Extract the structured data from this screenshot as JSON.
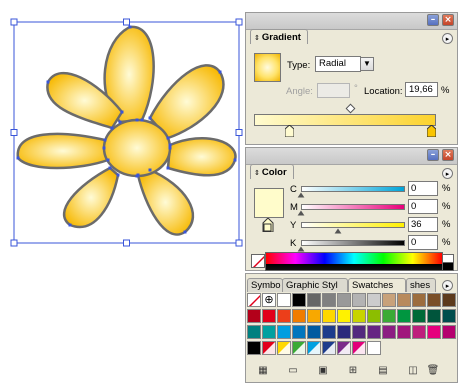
{
  "colors": {
    "panel_bg": "#ece9d8",
    "petal_fill_light": "#fffbd6",
    "petal_fill_dark": "#f7b800",
    "petal_stroke": "#6b6b6b",
    "selection": "#3a55d9",
    "accent_close": "#c4442a",
    "accent_min": "#5670c0"
  },
  "artboard": {
    "object": "flower-shape",
    "selected": true
  },
  "gradient_panel": {
    "tab_label": "Gradient",
    "type_label": "Type:",
    "type_value": "Radial",
    "angle_label": "Angle:",
    "angle_unit": "°",
    "location_label": "Location:",
    "location_value": "19,66",
    "location_unit": "%",
    "stops": [
      {
        "color": "#fffbd0",
        "position": 0
      },
      {
        "color": "#fcd22c",
        "position": 100
      }
    ],
    "midpoint": 53
  },
  "color_panel": {
    "tab_label": "Color",
    "swatch_color": "#fffccb",
    "channels": [
      {
        "label": "C",
        "value": "0",
        "unit": "%",
        "level": 0,
        "track": "linear-gradient(to right,#ffffff,#00a4d8)"
      },
      {
        "label": "M",
        "value": "0",
        "unit": "%",
        "level": 0,
        "track": "linear-gradient(to right,#ffffff,#e8007a)"
      },
      {
        "label": "Y",
        "value": "36",
        "unit": "%",
        "level": 36,
        "track": "linear-gradient(to right,#ffffff,#fff000)"
      },
      {
        "label": "K",
        "value": "0",
        "unit": "%",
        "level": 0,
        "track": "linear-gradient(to right,#ffffff,#000000)"
      }
    ]
  },
  "swatches_panel": {
    "tabs": [
      "Symbo",
      "Graphic Styl",
      "Swatches",
      "shes"
    ],
    "active_tab": "Swatches",
    "rows": [
      [
        "none",
        "registration",
        "#ffffff",
        "#000000",
        "#666666",
        "#808080",
        "#999999",
        "#b3b3b3",
        "#cccccc",
        "#c8a27a",
        "#b88a5c",
        "#9c6d3e",
        "#7a4f28",
        "#5c3a1c"
      ],
      [
        "#b3001a",
        "#e2001a",
        "#ec3e1a",
        "#f07c00",
        "#f8a800",
        "#ffd800",
        "#fff200",
        "#c8d400",
        "#8cbe00",
        "#3aaa35",
        "#009640",
        "#006a38",
        "#00553c",
        "#004d4d"
      ],
      [
        "#008080",
        "#00a0a0",
        "#009ee0",
        "#0076be",
        "#005aa0",
        "#1d3c8c",
        "#2b2a7c",
        "#52297e",
        "#662483",
        "#8c1d82",
        "#a0157c",
        "#be1e7c",
        "#e5007d",
        "#b4006e"
      ],
      [
        "#000000",
        "#e2001a",
        "#ffd800",
        "#3aaa35",
        "#00a0e0",
        "#1d3c8c",
        "#7a2a8a",
        "#e2007a",
        "#ffffff",
        "",
        "",
        "",
        "",
        ""
      ]
    ],
    "toolbar_icons": [
      "swatch-library-icon",
      "show-kinds-icon",
      "swatch-options-icon",
      "color-group-icon",
      "new-color-group-icon",
      "new-swatch-icon",
      "delete-swatch-icon"
    ]
  }
}
